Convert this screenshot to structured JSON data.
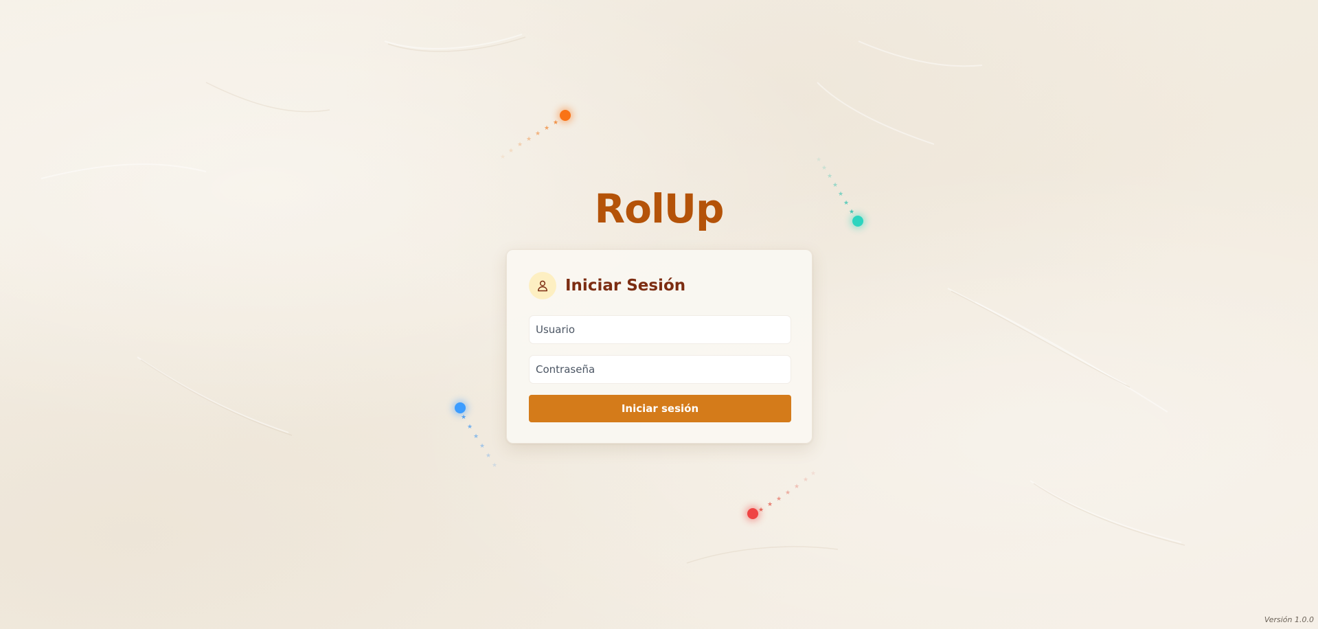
{
  "app": {
    "title": "RolUp",
    "version_label": "Versión 1.0.0"
  },
  "login": {
    "heading": "Iniciar Sesión",
    "username_placeholder": "Usuario",
    "username_value": "",
    "password_placeholder": "Contraseña",
    "password_value": "",
    "submit_label": "Iniciar sesión",
    "icon": "user-icon"
  },
  "decor": {
    "orbs": [
      {
        "name": "orange",
        "color": "#f97316"
      },
      {
        "name": "teal",
        "color": "#2dd4bf"
      },
      {
        "name": "blue",
        "color": "#3b9cff"
      },
      {
        "name": "red",
        "color": "#ef4444"
      }
    ],
    "trail_glyph": "★"
  },
  "colors": {
    "background": "#f4eee4",
    "title": "#b45309",
    "heading": "#7c2d12",
    "button": "#d47b1a",
    "icon_badge": "#fdefc2"
  }
}
